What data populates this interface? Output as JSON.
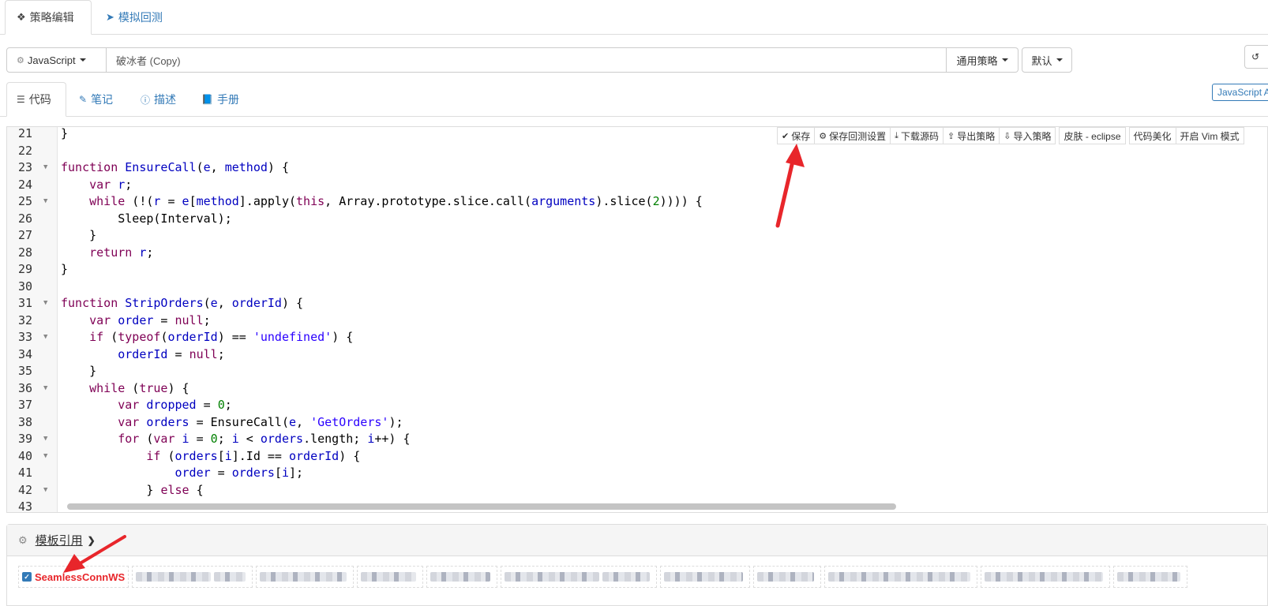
{
  "top_tabs": [
    {
      "icon": "cubes-icon",
      "label": "策略编辑"
    },
    {
      "icon": "rocket-icon",
      "label": "模拟回测"
    }
  ],
  "name_row": {
    "language": "JavaScript",
    "strategy_name": "破冰者  (Copy)",
    "strategy_type": "通用策略",
    "default_label": "默认"
  },
  "sub_tabs": [
    {
      "icon": "list-icon",
      "label": "代码"
    },
    {
      "icon": "edit-icon",
      "label": "笔记"
    },
    {
      "icon": "info-icon",
      "label": "描述"
    },
    {
      "icon": "book-icon",
      "label": "手册"
    }
  ],
  "api_badge": "JavaScript A",
  "toolbar": [
    {
      "icon": "check-icon",
      "label": "保存"
    },
    {
      "icon": "gear-icon",
      "label": "保存回测设置"
    },
    {
      "icon": "download-icon",
      "label": "下载源码"
    },
    {
      "icon": "export-icon",
      "label": "导出策略"
    },
    {
      "icon": "import-icon",
      "label": "导入策略"
    },
    {
      "icon": "",
      "label": "皮肤 - eclipse"
    },
    {
      "icon": "",
      "label": "代码美化"
    },
    {
      "icon": "",
      "label": "开启 Vim 模式"
    }
  ],
  "code_lines": [
    {
      "n": "21",
      "fold": false
    },
    {
      "n": "22",
      "fold": false
    },
    {
      "n": "23",
      "fold": true
    },
    {
      "n": "24",
      "fold": false
    },
    {
      "n": "25",
      "fold": true
    },
    {
      "n": "26",
      "fold": false
    },
    {
      "n": "27",
      "fold": false
    },
    {
      "n": "28",
      "fold": false
    },
    {
      "n": "29",
      "fold": false
    },
    {
      "n": "30",
      "fold": false
    },
    {
      "n": "31",
      "fold": true
    },
    {
      "n": "32",
      "fold": false
    },
    {
      "n": "33",
      "fold": true
    },
    {
      "n": "34",
      "fold": false
    },
    {
      "n": "35",
      "fold": false
    },
    {
      "n": "36",
      "fold": true
    },
    {
      "n": "37",
      "fold": false
    },
    {
      "n": "38",
      "fold": false
    },
    {
      "n": "39",
      "fold": true
    },
    {
      "n": "40",
      "fold": true
    },
    {
      "n": "41",
      "fold": false
    },
    {
      "n": "42",
      "fold": true
    },
    {
      "n": "43",
      "fold": false
    }
  ],
  "code_source": [
    "}",
    "",
    "function EnsureCall(e, method) {",
    "    var r;",
    "    while (!(r = e[method].apply(this, Array.prototype.slice.call(arguments).slice(2)))) {",
    "        Sleep(Interval);",
    "    }",
    "    return r;",
    "}",
    "",
    "function StripOrders(e, orderId) {",
    "    var order = null;",
    "    if (typeof(orderId) == 'undefined') {",
    "        orderId = null;",
    "    }",
    "    while (true) {",
    "        var dropped = 0;",
    "        var orders = EnsureCall(e, 'GetOrders');",
    "        for (var i = 0; i < orders.length; i++) {",
    "            if (orders[i].Id == orderId) {",
    "                order = orders[i];",
    "            } else {",
    ""
  ],
  "template_panel": {
    "title": "模板引用",
    "checked_item": "SeamlessConnWS",
    "blurred_item_count": 10
  },
  "colors": {
    "link": "#337ab7",
    "annotation_arrow": "#e8262b",
    "keyword": "#7f0055",
    "identifier": "#0000c0",
    "string": "#2a00ff",
    "number": "#008000"
  }
}
